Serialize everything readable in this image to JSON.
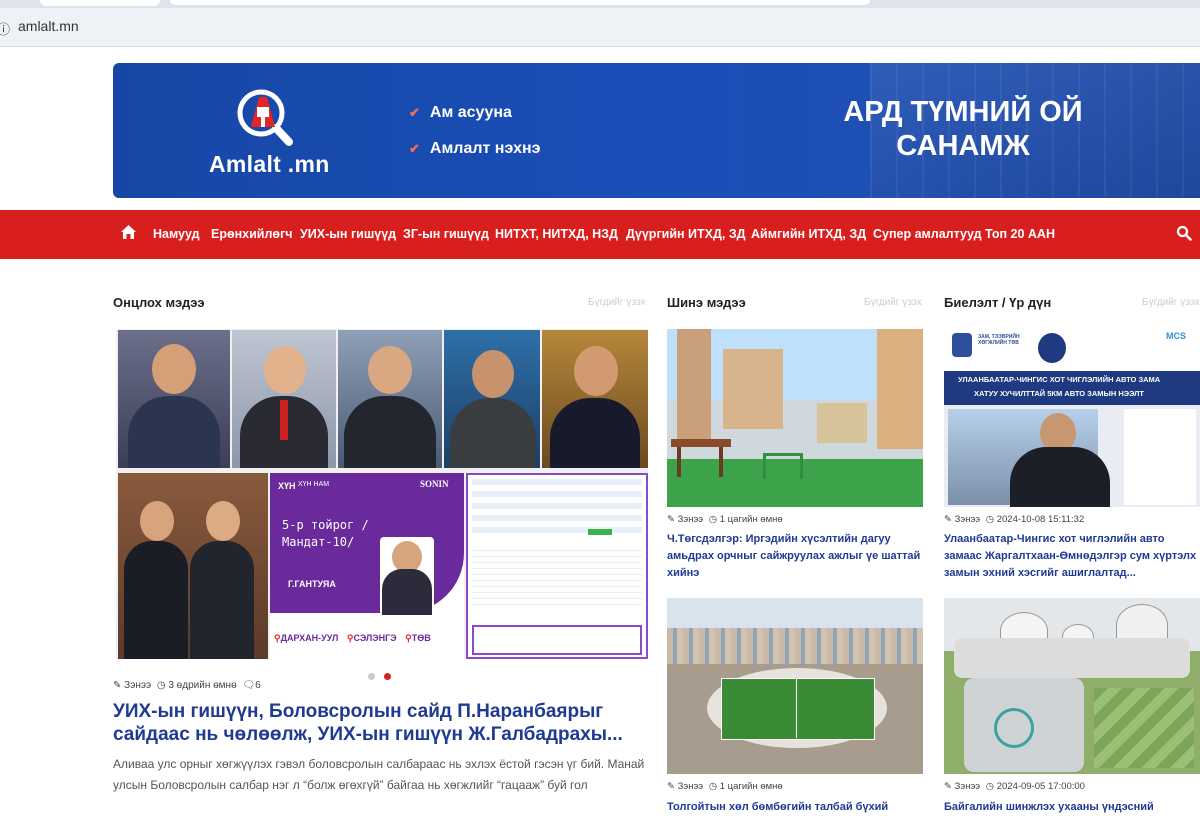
{
  "browser": {
    "url": "amlalt.mn",
    "site_icon": "site-info-icon"
  },
  "banner": {
    "logo_text": "Amlalt .mn",
    "slogans": [
      "Ам асууна",
      "Амлалт нэхнэ"
    ],
    "tagline": "АРД ТҮМНИЙ ОЙ САНАМЖ",
    "colors": {
      "banner": "#1a4fb8",
      "accent": "#ff6b4a"
    }
  },
  "nav": {
    "items": [
      "Намууд",
      "Ерөнхийлөгч",
      "УИХ-ын гишүүд",
      "ЗГ-ын гишүүд",
      "НИТХТ, НИТХД, НЗД",
      "Дүүргийн ИТХД, ЗД",
      "Аймгийн ИТХД, ЗД",
      "Супер амлалтууд",
      "Топ 20 ААН"
    ],
    "icons": [
      "home-icon",
      "search-icon"
    ],
    "color": "#d91e1e"
  },
  "featured": {
    "heading": "Онцлох мэдээ",
    "more": "Бүгдийг үзэх",
    "slide": {
      "brand_left": "ХҮН",
      "brand_left2": "ХҮН НАМ",
      "brand_right": "SONIN",
      "mandate": "5-р тойрог /Мандат-10/",
      "name": "Г.ГАНТУЯА",
      "places": [
        "ДАРХАН-УУЛ",
        "СЭЛЭНГЭ",
        "ТӨВ"
      ]
    },
    "article": {
      "author": "Зэнээ",
      "time": "3 өдрийн өмнө",
      "comments": "6",
      "title": "УИХ-ын гишүүн, Боловсролын сайд П.Наранбаярыг сайдаас нь чөлөөлж, УИХ-ын гишүүн Ж.Галбадрахы...",
      "excerpt": "Аливаа улс орныг хөгжүүлэх гэвэл боловсролын салбараас нь эхлэх ёстой гэсэн үг бий. Манай улсын Боловсролын салбар нэг л “болж өгөхгүй” байгаа нь хөгжлийг “гацааж” буй гол"
    },
    "slider_dots": {
      "count": 2,
      "active": 2
    }
  },
  "latest": {
    "heading": "Шинэ мэдээ",
    "more": "Бүгдийг үзэх",
    "cards": [
      {
        "author": "Зэнээ",
        "time": "1 цагийн өмнө",
        "title": "Ч.Төгсдэлгэр: Иргэдийн хүсэлтийн дагуу амьдрах орчныг сайжруулах ажлыг үе шаттай хийнэ"
      },
      {
        "author": "Зэнээ",
        "time": "1 цагийн өмнө",
        "title": "Толгойтын хөл бөмбөгийн талбай бүхий"
      }
    ]
  },
  "results": {
    "heading": "Биелэлт / Үр дүн",
    "more": "Бүгдийг үзэх",
    "card1_image": {
      "org": "ЗАМ, ТЭЭВРИЙН ХӨГЖЛИЙН ТӨВ",
      "banner_line1": "УЛААНБААТАР-ЧИНГИС ХОТ ЧИГЛЭЛИЙН АВТО ЗАМА",
      "banner_line2": "ХАТУУ ХУЧИЛТТАЙ 5КМ АВТО ЗАМЫН НЭЭЛТ",
      "logo_tag": "MCS"
    },
    "cards": [
      {
        "author": "Зэнээ",
        "time": "2024-10-08 15:11:32",
        "title": "Улаанбаатар-Чингис хот чиглэлийн авто замаас Жаргалтхаан-Өмнөдэлгэр сум хүртэлх замын эхний хэсгийг ашиглалтад..."
      },
      {
        "author": "Зэнээ",
        "time": "2024-09-05 17:00:00",
        "title": "Байгалийн шинжлэх ухааны үндэсний"
      }
    ]
  }
}
